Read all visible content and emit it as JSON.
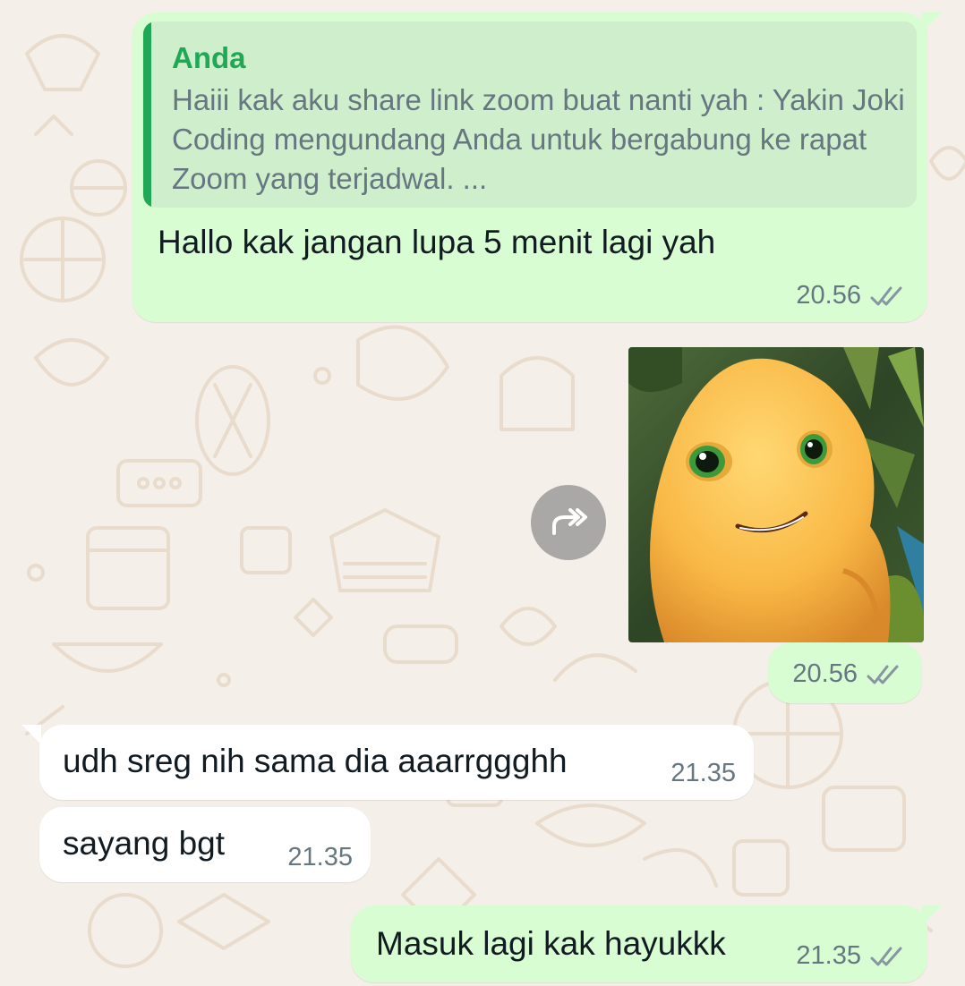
{
  "chat": {
    "messages": [
      {
        "direction": "outgoing",
        "reply": {
          "author": "Anda",
          "text": "Haiii kak aku share link zoom buat nanti yah : Yakin Joki Coding mengundang Anda untuk bergabung ke rapat Zoom yang terjadwal. ..."
        },
        "text": "Hallo kak jangan lupa 5 menit lagi yah",
        "time": "20.56",
        "status": "read"
      },
      {
        "direction": "outgoing",
        "image": "yellow-cartoon-creature-photo",
        "time": "20.56",
        "status": "read"
      },
      {
        "direction": "incoming",
        "text": "udh sreg nih sama dia aaarrggghh",
        "time": "21.35"
      },
      {
        "direction": "incoming",
        "text": "sayang bgt",
        "time": "21.35"
      },
      {
        "direction": "outgoing",
        "text": "Masuk lagi kak hayukkk",
        "time": "21.35",
        "status": "read"
      }
    ]
  },
  "icons": {
    "forward": "forward-icon",
    "read_receipt": "double-check-icon"
  },
  "colors": {
    "wallpaper": "#f4efe8",
    "doodle": "#e9dccd",
    "outgoing_bubble": "#d9fdd3",
    "incoming_bubble": "#ffffff",
    "quote_bg": "#cfeecb",
    "quote_accent": "#1fa855",
    "meta_text": "#667781",
    "message_text": "#111b21"
  }
}
